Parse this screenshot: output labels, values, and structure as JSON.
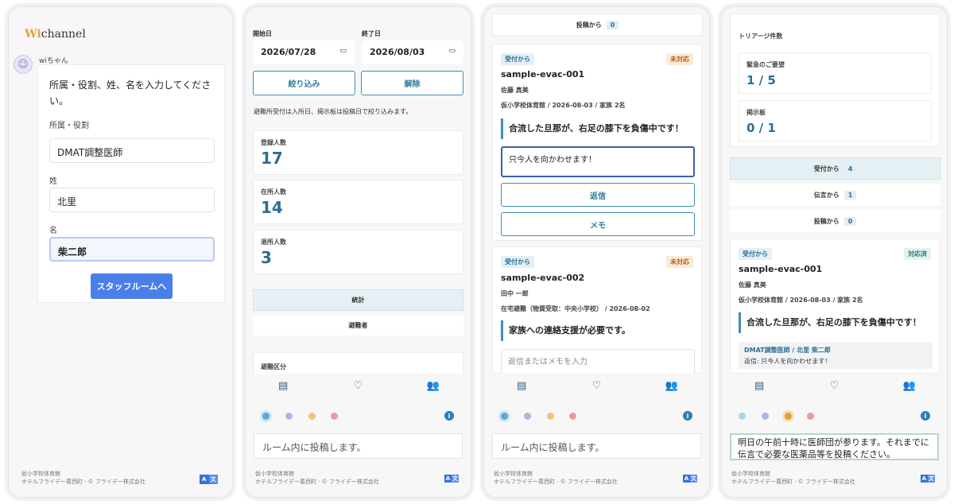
{
  "panel1": {
    "logo_wi": "Wi",
    "logo_rest": "channel",
    "sender": "wiちゃん",
    "message": "所属・役割、姓、名を入力してください。",
    "fields": [
      {
        "label": "所属・役割",
        "value": "DMAT調整医師"
      },
      {
        "label": "姓",
        "value": "北里"
      },
      {
        "label": "名",
        "value": "柴二郎"
      }
    ],
    "submit_label": "スタッフルームへ",
    "footer_line1": "仮小学校体育館",
    "footer_line2": "ホテルフライデー葛西町 · © フライデー株式会社",
    "lang_a": "A",
    "lang_b": "文"
  },
  "panel2": {
    "start_label": "開始日",
    "end_label": "終了日",
    "start_value": "2026/07/28",
    "end_value": "2026/08/03",
    "filter_label": "絞り込み",
    "clear_label": "解除",
    "note": "避難所受付は入所日、掲示板は投稿日で絞り込みます。",
    "stats": [
      {
        "label": "登録人数",
        "value": "17"
      },
      {
        "label": "在所人数",
        "value": "14"
      },
      {
        "label": "退所人数",
        "value": "3"
      }
    ],
    "tab_stats": "統計",
    "tab_evacuees": "避難者",
    "section_label": "避難区分",
    "post_placeholder": "ルーム内に投稿します。",
    "footer_line1": "仮小学校体育館",
    "footer_line2": "ホテルフライデー葛西町 · © フライデー株式会社"
  },
  "panel3": {
    "top_filter": {
      "label": "投稿から",
      "count": "0"
    },
    "cards": [
      {
        "source": "受付から",
        "status": "未対応",
        "id": "sample-evac-001",
        "name": "佐藤 真美",
        "meta": "仮小学校体育館 / 2026-08-03 / 家族 2名",
        "message": "合流した旦那が、右足の膝下を負傷中です！",
        "reply_value": "只今人を向かわせます！",
        "reply_label": "返信",
        "memo_label": "メモ"
      },
      {
        "source": "受付から",
        "status": "未対応",
        "id": "sample-evac-002",
        "name": "田中 一郎",
        "meta": "在宅避難（物資受取：中央小学校） / 2026-08-02",
        "message": "家族への連絡支援が必要です。",
        "reply_placeholder": "返信またはメモを入力"
      }
    ],
    "post_placeholder": "ルーム内に投稿します。",
    "footer_line1": "仮小学校体育館",
    "footer_line2": "ホテルフライデー葛西町 · © フライデー株式会社"
  },
  "panel4": {
    "triage_title": "トリアージ件数",
    "triage": [
      {
        "label": "緊急のご要望",
        "value": "1 / 5"
      },
      {
        "label": "掲示板",
        "value": "0 / 1"
      }
    ],
    "filters": [
      {
        "label": "受付から",
        "count": "4"
      },
      {
        "label": "伝言から",
        "count": "1"
      },
      {
        "label": "投稿から",
        "count": "0"
      }
    ],
    "card": {
      "source": "受付から",
      "status": "対応済",
      "id": "sample-evac-001",
      "name": "佐藤 真美",
      "meta": "仮小学校体育館 / 2026-08-03 / 家族 2名",
      "message": "合流した旦那が、右足の膝下を負傷中です！",
      "reply_author": "DMAT調整医師 / 北里 柴二郎",
      "reply_text": "返信: 只今人を向かわせます！"
    },
    "post_value": "明日の午前十時に医師団が参ります。それまでに伝言で必要な医薬品等を投稿ください。",
    "footer_line1": "仮小学校体育館",
    "footer_line2": "ホテルフライデー葛西町 · © フライデー株式会社"
  },
  "colors": {
    "accent": "#2c6e8e",
    "primary_button": "#4a7ee8",
    "dot_blue": "#5aa9d6",
    "dot_lavender": "#a8b8e8",
    "dot_yellow": "#f0c476",
    "dot_red": "#ef9a9a"
  },
  "icons": [
    "clipboard-icon",
    "hand-heart-icon",
    "users-icon",
    "info-icon",
    "calendar-icon",
    "translate-icon"
  ]
}
